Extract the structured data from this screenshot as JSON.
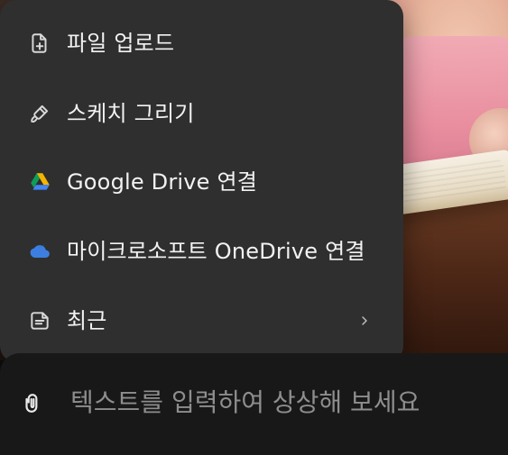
{
  "menu": {
    "items": [
      {
        "label": "파일 업로드",
        "icon": "file-upload-icon"
      },
      {
        "label": "스케치 그리기",
        "icon": "brush-icon"
      },
      {
        "label": "Google Drive 연결",
        "icon": "google-drive-icon"
      },
      {
        "label": "마이크로소프트 OneDrive 연결",
        "icon": "onedrive-icon"
      },
      {
        "label": "최근",
        "icon": "recent-note-icon",
        "submenu_icon": "chevron-right-icon"
      }
    ]
  },
  "composer": {
    "placeholder": "텍스트를 입력하여 상상해 보세요",
    "attach_icon": "paperclip-icon"
  },
  "colors": {
    "menu_bg": "#2f2f2f",
    "menu_text": "#f2f2f2",
    "composer_bg": "#181818",
    "placeholder_text": "#8e8e8e"
  }
}
